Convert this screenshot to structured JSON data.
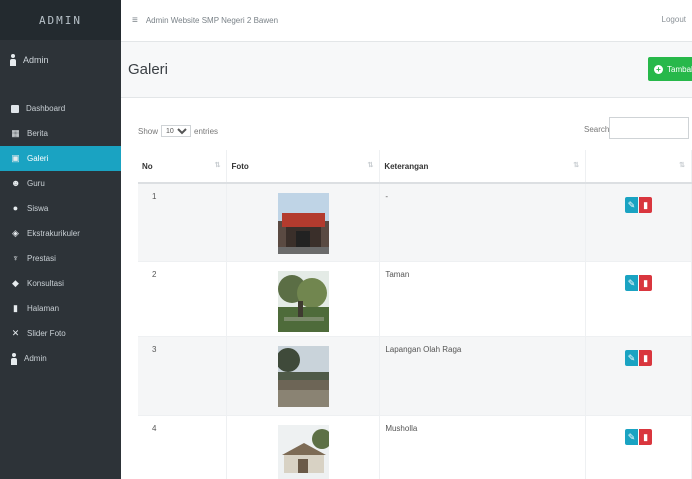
{
  "sidebar": {
    "brand": "ADMIN",
    "user": "Admin",
    "items": [
      {
        "label": "Dashboard",
        "active": false
      },
      {
        "label": "Berita",
        "active": false
      },
      {
        "label": "Galeri",
        "active": true
      },
      {
        "label": "Guru",
        "active": false
      },
      {
        "label": "Siswa",
        "active": false
      },
      {
        "label": "Ekstrakurikuler",
        "active": false
      },
      {
        "label": "Prestasi",
        "active": false
      },
      {
        "label": "Konsultasi",
        "active": false
      },
      {
        "label": "Halaman",
        "active": false
      },
      {
        "label": "Slider Foto",
        "active": false
      },
      {
        "label": "Admin",
        "active": false
      }
    ]
  },
  "topbar": {
    "menu_icon": "≡",
    "breadcrumb": "Admin Website SMP Negeri 2 Bawen",
    "logout": "Logout"
  },
  "page": {
    "title": "Galeri",
    "add_button": "Tambah"
  },
  "table_controls": {
    "show_label": "Show",
    "show_value": "10",
    "entries_label": "entries",
    "search_label": "Search:"
  },
  "table": {
    "headers": [
      "No",
      "Foto",
      "Keterangan",
      ""
    ],
    "rows": [
      {
        "no": "1",
        "keterangan": "-"
      },
      {
        "no": "2",
        "keterangan": "Taman"
      },
      {
        "no": "3",
        "keterangan": "Lapangan Olah Raga"
      },
      {
        "no": "4",
        "keterangan": "Musholla"
      }
    ]
  },
  "colors": {
    "sidebar": "#2d3338",
    "active": "#1aa3c2",
    "add_button": "#27b84a",
    "edit": "#1aa3c2",
    "delete": "#d9363e"
  }
}
